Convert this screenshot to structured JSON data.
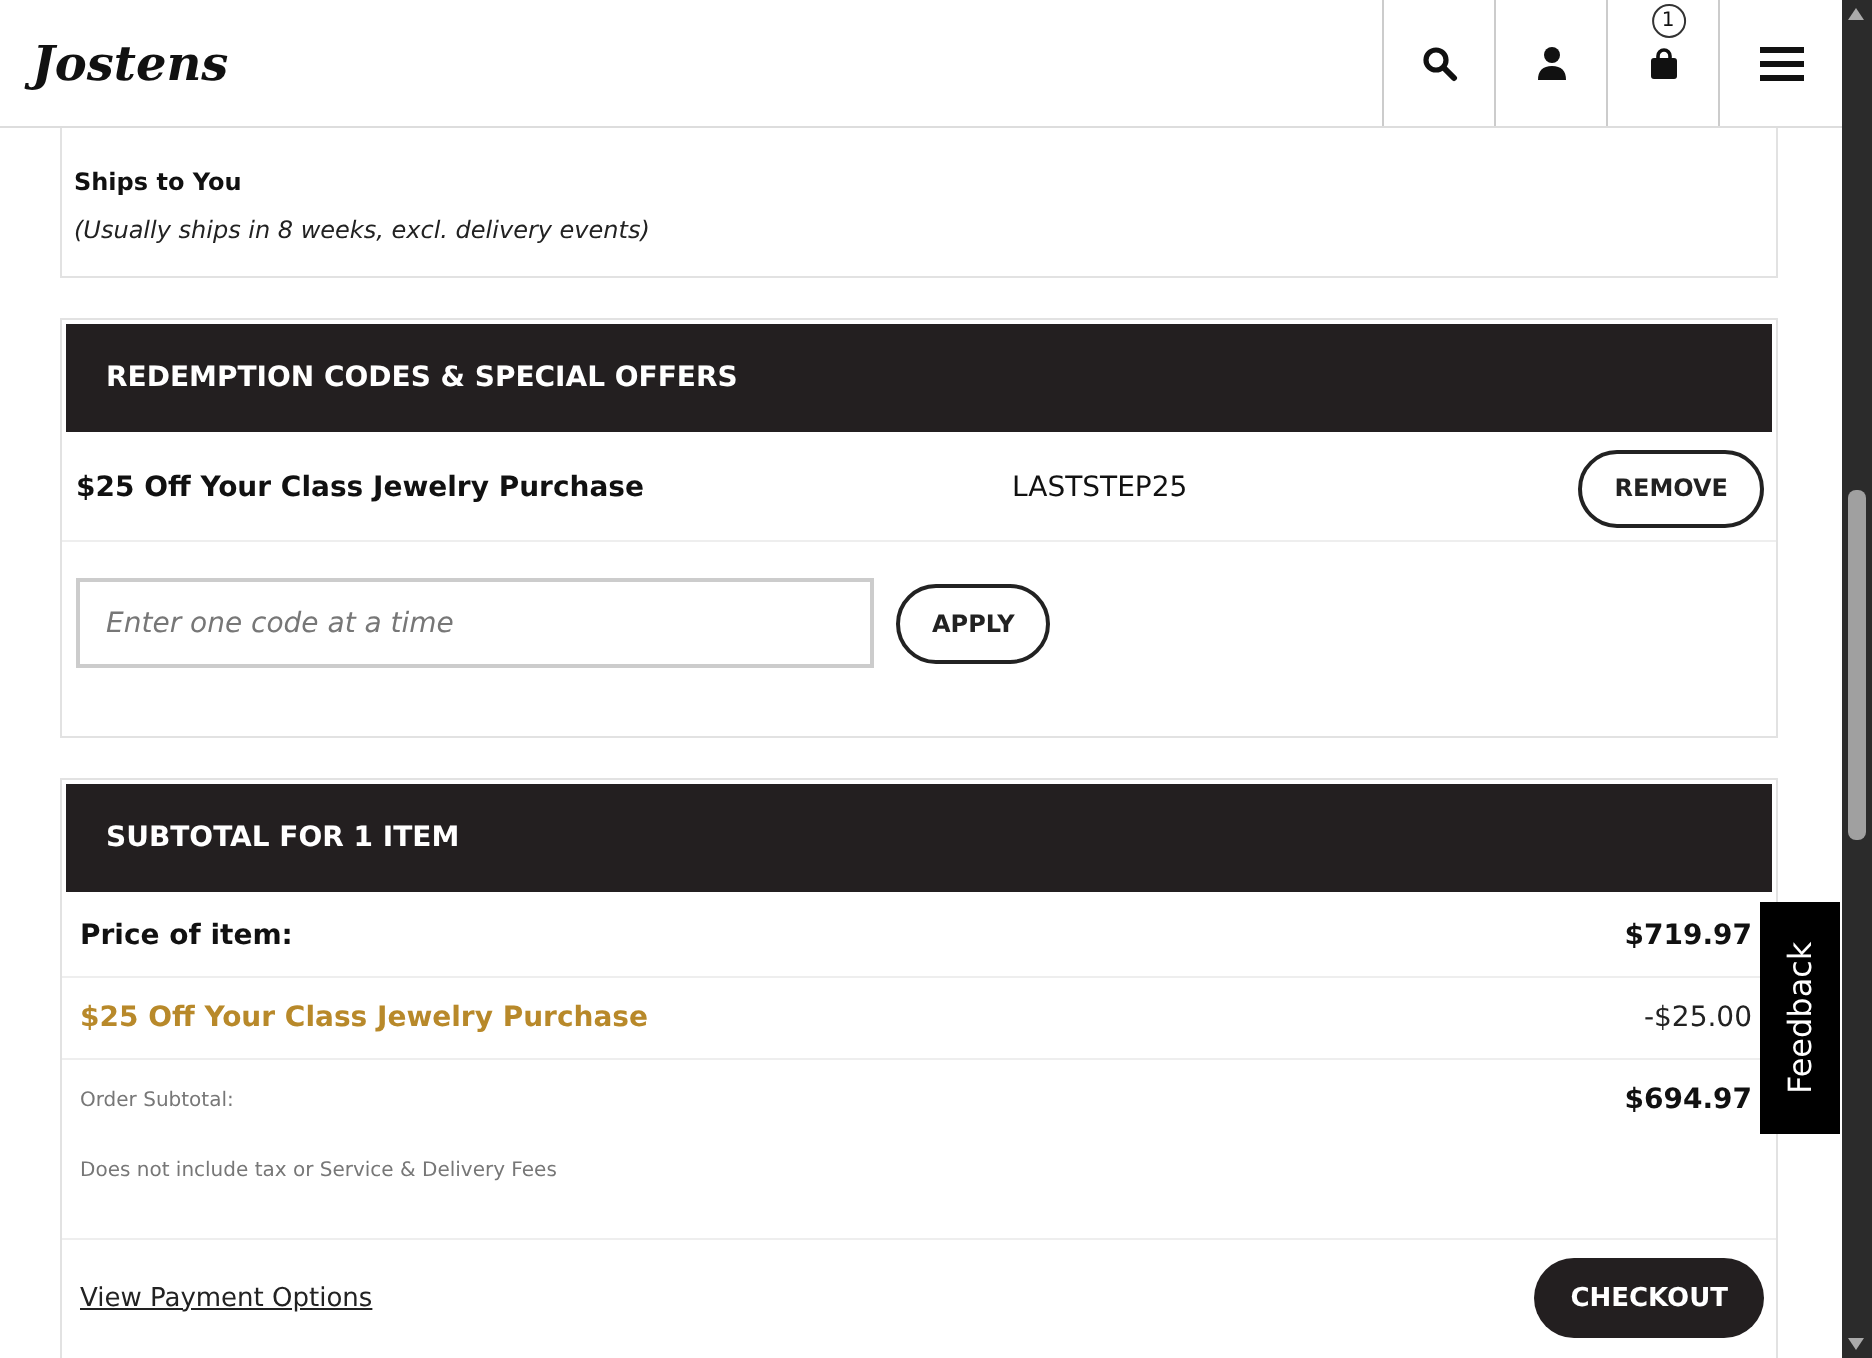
{
  "header": {
    "logo": "Jostens",
    "cart_count": "1"
  },
  "shipping": {
    "method": "Ships to You",
    "note": "(Usually ships in 8 weeks, excl. delivery events)"
  },
  "codes": {
    "title": "REDEMPTION CODES & SPECIAL OFFERS",
    "applied": [
      {
        "name": "$25 Off Your Class Jewelry Purchase",
        "code": "LASTSTEP25",
        "button": "REMOVE"
      }
    ],
    "placeholder": "Enter one code at a time",
    "apply": "APPLY"
  },
  "subtotal": {
    "title": "SUBTOTAL FOR 1 ITEM",
    "rows": [
      {
        "kind": "main",
        "label": "Price of item:",
        "amount": "$719.97"
      },
      {
        "kind": "discount",
        "label": "$25 Off Your Class Jewelry Purchase",
        "amount": "-$25.00"
      },
      {
        "kind": "small",
        "label": "Order Subtotal:",
        "amount": "$694.97"
      }
    ],
    "note": "Does not include tax or Service & Delivery Fees",
    "link": "View Payment Options",
    "checkout": "CHECKOUT"
  },
  "feedback": "Feedback"
}
